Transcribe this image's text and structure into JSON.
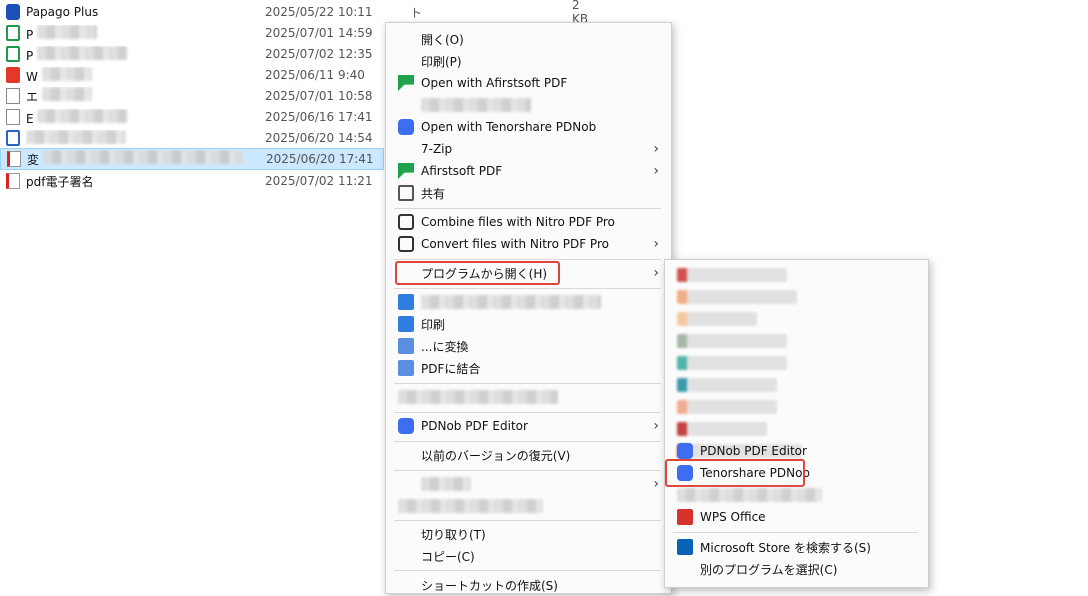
{
  "files": [
    {
      "name": "Papago Plus",
      "date": "2025/05/22 10:11",
      "type": "ショートカット",
      "size": "2 KB",
      "icon": "app-icon"
    },
    {
      "name": "P",
      "date": "2025/07/01 14:59",
      "icon": "sheet-icon"
    },
    {
      "name": "P",
      "date": "2025/07/02 12:35",
      "icon": "sheet-icon"
    },
    {
      "name": "W",
      "date": "2025/06/11 9:40",
      "icon": "wps-icon"
    },
    {
      "name": "エ",
      "date": "2025/07/01 10:58",
      "icon": "text-file-icon"
    },
    {
      "name": "E",
      "date": "2025/06/16 17:41",
      "icon": "text-file-icon"
    },
    {
      "name": "",
      "date": "2025/06/20 14:54",
      "icon": "word-icon"
    },
    {
      "name": "変",
      "date": "2025/06/20 17:41",
      "icon": "pdf-icon",
      "selected": true
    },
    {
      "name": "pdf電子署名",
      "date": "2025/07/02 11:21",
      "icon": "pdf-icon"
    }
  ],
  "context_menu": {
    "open": "開く(O)",
    "print": "印刷(P)",
    "open_afirstsoft": "Open with Afirstsoft PDF",
    "open_tenorshare": "Open with Tenorshare PDNob",
    "zip": "7-Zip",
    "afirstsoft": "Afirstsoft PDF",
    "share": "共有",
    "combine_nitro": "Combine files with Nitro PDF Pro",
    "convert_nitro": "Convert files with Nitro PDF Pro",
    "open_with": "プログラムから開く(H)",
    "print2": "印刷",
    "convert": "...に変換",
    "pdf_combine": "PDFに結合",
    "pdnob_editor": "PDNob PDF Editor",
    "restore": "以前のバージョンの復元(V)",
    "cut": "切り取り(T)",
    "copy": "コピー(C)",
    "create_shortcut": "ショートカットの作成(S)"
  },
  "submenu": {
    "pdnob_editor": "PDNob PDF Editor",
    "tenorshare_pdnob": "Tenorshare PDNob",
    "wps_office": "WPS Office",
    "ms_store": "Microsoft Store を検索する(S)",
    "choose_other": "別のプログラムを選択(C)"
  },
  "colors": {
    "selection": "#cce8ff",
    "highlight_box": "#e0453a",
    "accent_pdnob": "#3d6df0"
  }
}
